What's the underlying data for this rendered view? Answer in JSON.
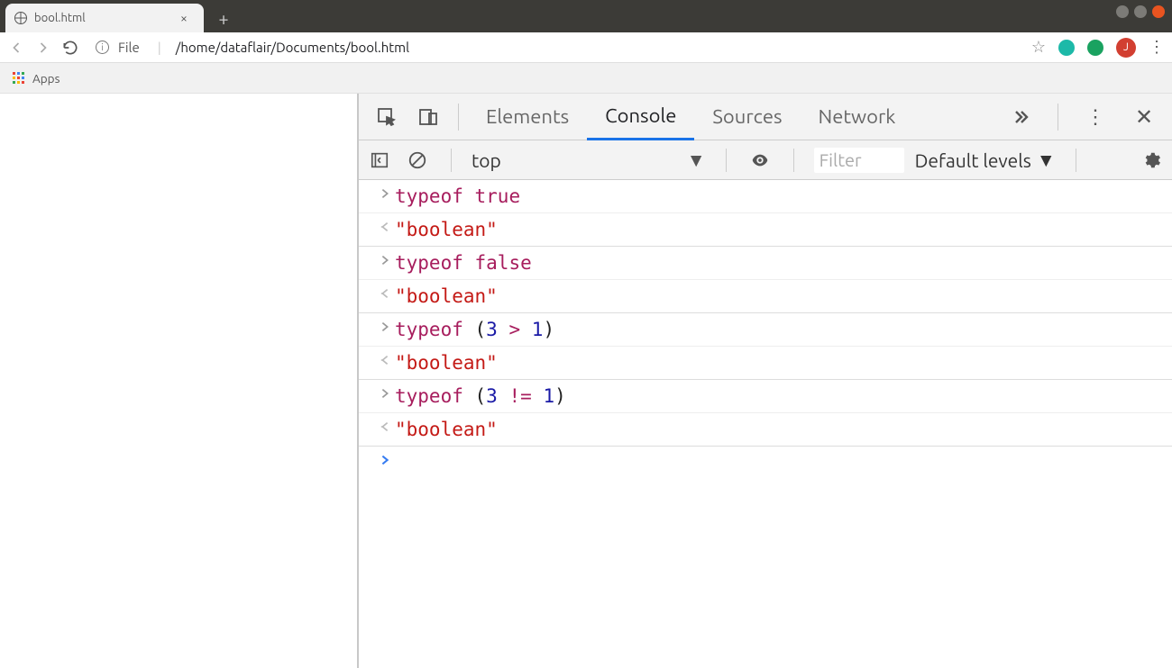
{
  "tab": {
    "title": "bool.html"
  },
  "url": {
    "scheme": "File",
    "path": "/home/dataflair/Documents/bool.html"
  },
  "bookmarks": {
    "apps_label": "Apps"
  },
  "avatar_letter": "J",
  "devtools": {
    "tabs": {
      "elements": "Elements",
      "console": "Console",
      "sources": "Sources",
      "network": "Network"
    },
    "context": "top",
    "filter_placeholder": "Filter",
    "levels": "Default levels"
  },
  "console": {
    "entries": [
      {
        "input_tokens": [
          [
            "keyword",
            "typeof"
          ],
          [
            "space",
            " "
          ],
          [
            "bool",
            "true"
          ]
        ],
        "output": "\"boolean\""
      },
      {
        "input_tokens": [
          [
            "keyword",
            "typeof"
          ],
          [
            "space",
            " "
          ],
          [
            "bool",
            "false"
          ]
        ],
        "output": "\"boolean\""
      },
      {
        "input_tokens": [
          [
            "keyword",
            "typeof"
          ],
          [
            "space",
            " "
          ],
          [
            "punc",
            "("
          ],
          [
            "num",
            "3"
          ],
          [
            "space",
            " "
          ],
          [
            "op",
            ">"
          ],
          [
            "space",
            " "
          ],
          [
            "num",
            "1"
          ],
          [
            "punc",
            ")"
          ]
        ],
        "output": "\"boolean\""
      },
      {
        "input_tokens": [
          [
            "keyword",
            "typeof"
          ],
          [
            "space",
            " "
          ],
          [
            "punc",
            "("
          ],
          [
            "num",
            "3"
          ],
          [
            "space",
            " "
          ],
          [
            "op",
            "!="
          ],
          [
            "space",
            " "
          ],
          [
            "num",
            "1"
          ],
          [
            "punc",
            ")"
          ]
        ],
        "output": "\"boolean\""
      }
    ]
  }
}
